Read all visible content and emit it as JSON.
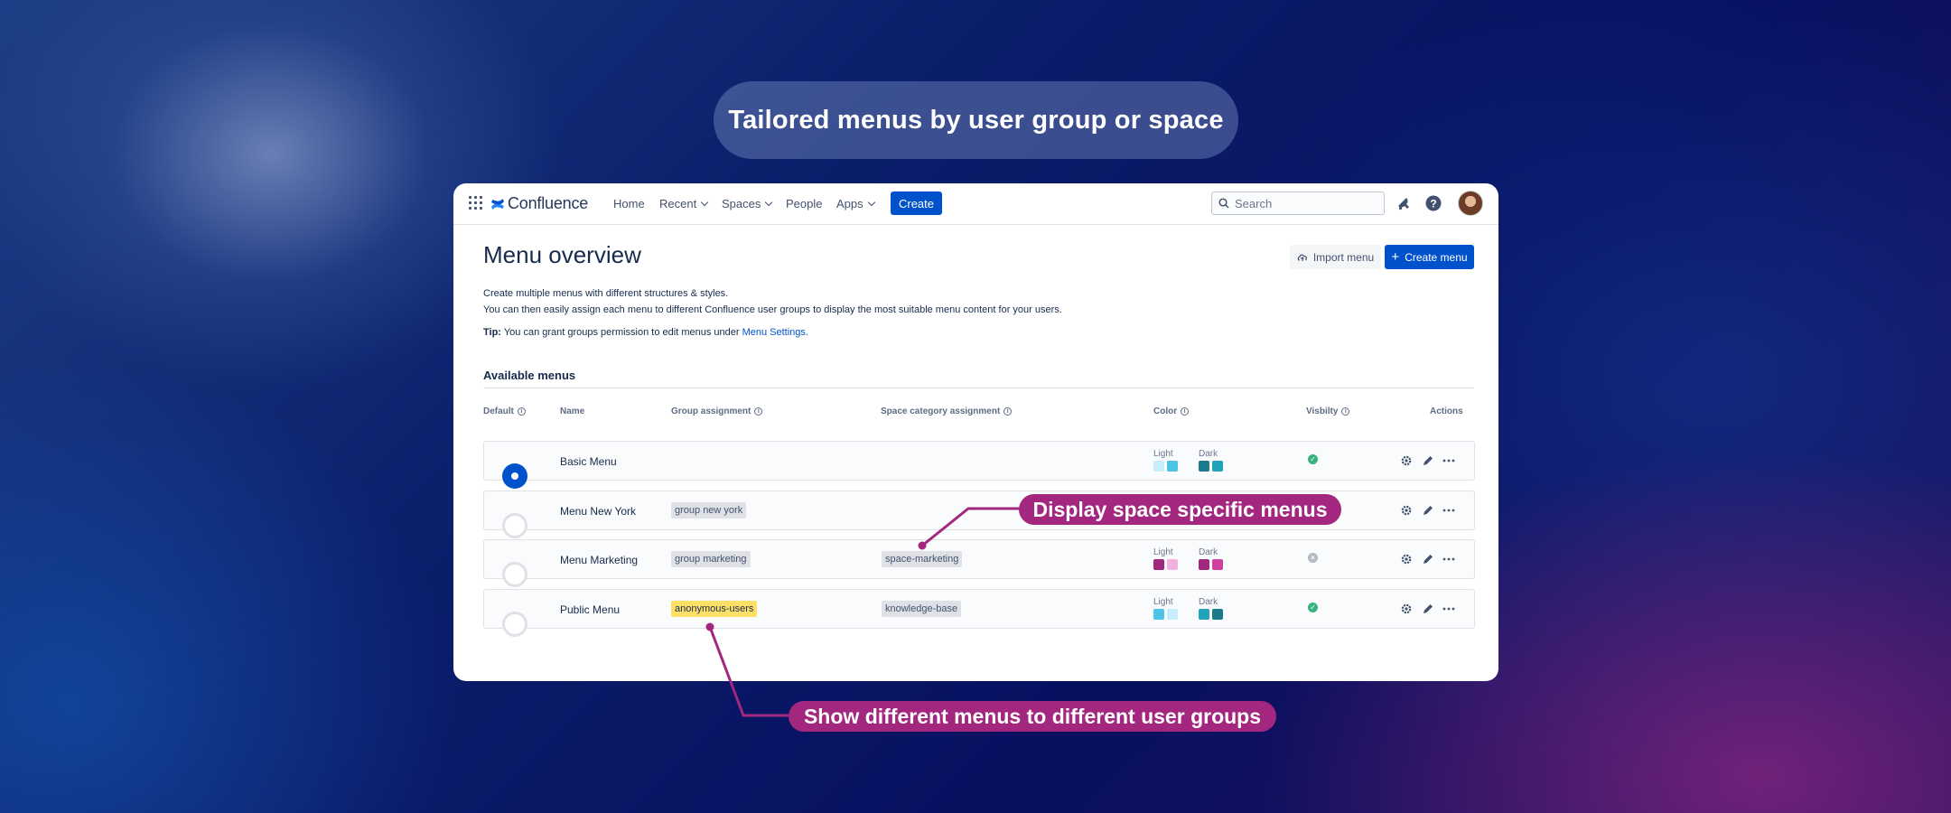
{
  "hero_title": "Tailored menus by user group or space",
  "nav": {
    "brand": "Confluence",
    "items": [
      "Home",
      "Recent",
      "Spaces",
      "People",
      "Apps"
    ],
    "create_label": "Create",
    "search_placeholder": "Search"
  },
  "page": {
    "title": "Menu overview",
    "import_label": "Import menu",
    "create_menu_label": "Create menu",
    "desc_line1": "Create multiple menus with different structures & styles.",
    "desc_line2": "You can then easily assign each menu to different Confluence user groups to display the most suitable menu content for your users.",
    "tip_label": "Tip:",
    "tip_text": "You can grant groups permission to edit menus under",
    "tip_link": "Menu Settings."
  },
  "table": {
    "section_title": "Available menus",
    "headers": {
      "default": "Default",
      "name": "Name",
      "group": "Group assignment",
      "space": "Space category assignment",
      "color": "Color",
      "visibility": "Visbilty",
      "actions": "Actions"
    },
    "light_label": "Light",
    "dark_label": "Dark",
    "rows": [
      {
        "name": "Basic Menu",
        "default": true,
        "group": "",
        "space": "",
        "visible": true,
        "light": [
          "#c6edfb",
          "#4bc4e6"
        ],
        "dark": [
          "#1d7a8c",
          "#1fa4b8"
        ]
      },
      {
        "name": "Menu New York",
        "default": false,
        "group": "group new york",
        "space": "",
        "visible": null,
        "light": [],
        "dark": []
      },
      {
        "name": "Menu Marketing",
        "default": false,
        "group": "group marketing",
        "space": "space-marketing",
        "visible": false,
        "light": [
          "#a3267f",
          "#f0b3e0"
        ],
        "dark": [
          "#a3267f",
          "#d2409f"
        ]
      },
      {
        "name": "Public Menu",
        "default": false,
        "group": "anonymous-users",
        "space": "knowledge-base",
        "visible": true,
        "light": [
          "#4bc4e6",
          "#c6edfb"
        ],
        "dark": [
          "#1fa4b8",
          "#1d7a8c"
        ]
      }
    ]
  },
  "callouts": {
    "space": "Display space specific menus",
    "groups": "Show different menus to different user groups"
  },
  "colors": {
    "accent": "#0052cc",
    "callout": "#a3267f",
    "success": "#36b37e"
  }
}
